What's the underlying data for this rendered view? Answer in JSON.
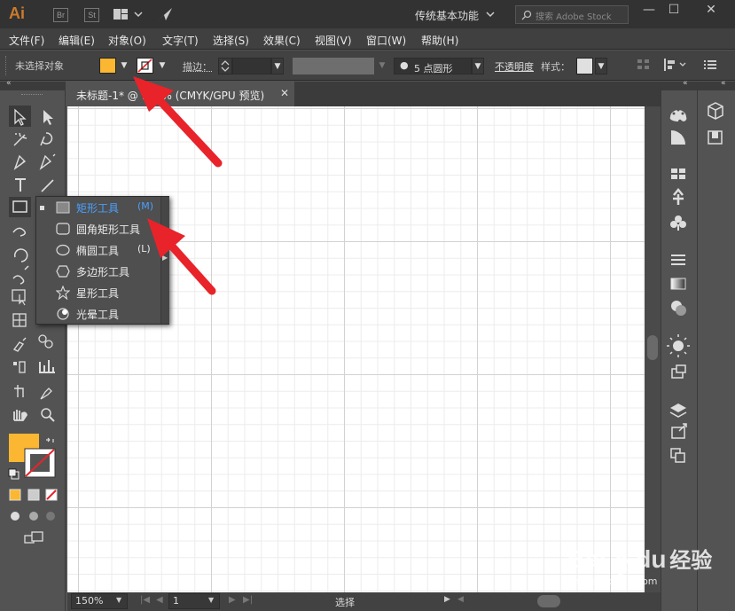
{
  "app": {
    "logo": "Ai",
    "badges": [
      "Br",
      "St"
    ],
    "workspace": "传统基本功能",
    "search_placeholder": "搜索 Adobe Stock"
  },
  "window_controls": {
    "minimize": "—",
    "maximize": "☐",
    "close": "✕"
  },
  "menu": [
    "文件(F)",
    "编辑(E)",
    "对象(O)",
    "文字(T)",
    "选择(S)",
    "效果(C)",
    "视图(V)",
    "窗口(W)",
    "帮助(H)"
  ],
  "control_bar": {
    "selection_status": "未选择对象",
    "stroke_label": "描边：",
    "brush_label": "5 点圆形",
    "opacity_label": "不透明度",
    "style_label": "样式："
  },
  "document_tab": {
    "title": "未标题-1* @ 150% (CMYK/GPU 预览)",
    "close": "✕"
  },
  "flyout": {
    "items": [
      {
        "label": "矩形工具",
        "shortcut": "(M)",
        "icon": "rectangle-icon",
        "active": true
      },
      {
        "label": "圆角矩形工具",
        "shortcut": "",
        "icon": "rounded-rectangle-icon",
        "active": false
      },
      {
        "label": "椭圆工具",
        "shortcut": "(L)",
        "icon": "ellipse-icon",
        "active": false
      },
      {
        "label": "多边形工具",
        "shortcut": "",
        "icon": "polygon-icon",
        "active": false
      },
      {
        "label": "星形工具",
        "shortcut": "",
        "icon": "star-icon",
        "active": false
      },
      {
        "label": "光晕工具",
        "shortcut": "",
        "icon": "flare-icon",
        "active": false
      }
    ]
  },
  "status_bar": {
    "zoom": "150%",
    "page": "1",
    "tool_status": "选择"
  },
  "watermark": {
    "brand": "Bai",
    "brand2": "du",
    "product": "经验",
    "url": "jingyan.baidu.com"
  },
  "colors": {
    "fill": "#fbb731",
    "accent_blue": "#4aa0ff",
    "arrow_red": "#e8232a",
    "title_bg": "#323232",
    "panel_bg": "#535353"
  }
}
